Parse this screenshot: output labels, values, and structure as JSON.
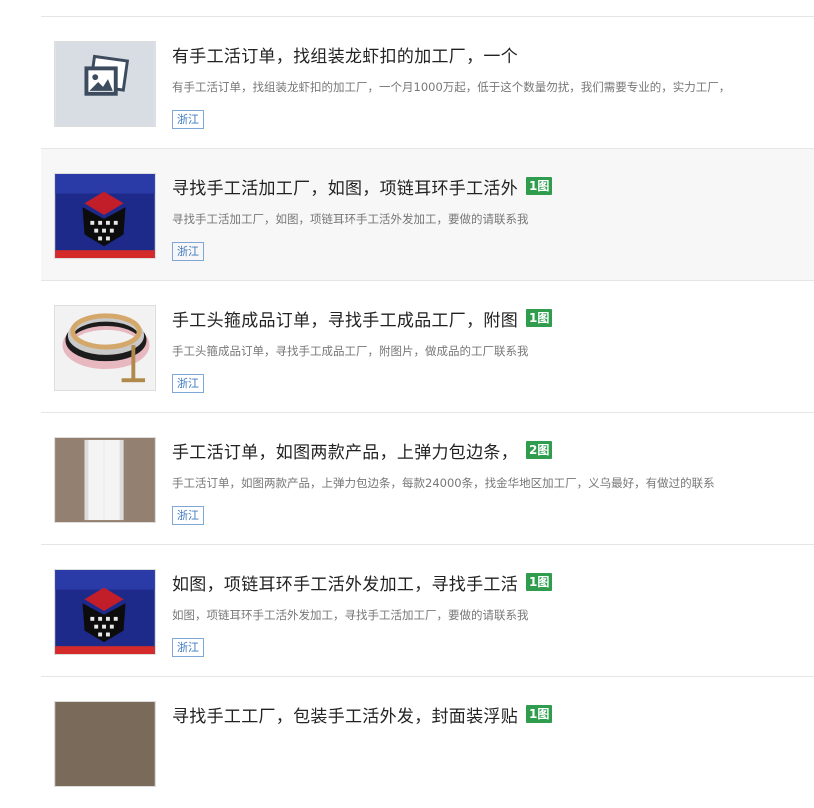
{
  "listings": [
    {
      "title": "有手工活订单，找组装龙虾扣的加工厂，一个",
      "description": "有手工活订单，找组装龙虾扣的加工厂，一个月1000万起，低于这个数量勿扰，我们需要专业的，实力工厂，",
      "region": "浙江",
      "badge": "",
      "image": "placeholder"
    },
    {
      "title": "寻找手工活加工厂，如图，项链耳环手工活外",
      "description": "寻找手工活加工厂，如图，项链耳环手工活外发加工，要做的请联系我",
      "region": "浙江",
      "badge": "1图",
      "image": "jewelry-photo"
    },
    {
      "title": "手工头箍成品订单，寻找手工成品工厂，附图",
      "description": "手工头箍成品订单，寻找手工成品工厂，附图片，做成品的工厂联系我",
      "region": "浙江",
      "badge": "1图",
      "image": "headband-photo"
    },
    {
      "title": "手工活订单，如图两款产品，上弹力包边条，",
      "description": "手工活订单，如图两款产品，上弹力包边条，每款24000条，找金华地区加工厂，义乌最好，有做过的联系",
      "region": "浙江",
      "badge": "2图",
      "image": "fabric-photo"
    },
    {
      "title": "如图，项链耳环手工活外发加工，寻找手工活",
      "description": "如图，项链耳环手工活外发加工，寻找手工活加工厂，要做的请联系我",
      "region": "浙江",
      "badge": "1图",
      "image": "jewelry-photo"
    },
    {
      "title": "寻找手工工厂，包装手工活外发，封面装浮贴",
      "description": "",
      "region": "",
      "badge": "1图",
      "image": "partial"
    }
  ]
}
